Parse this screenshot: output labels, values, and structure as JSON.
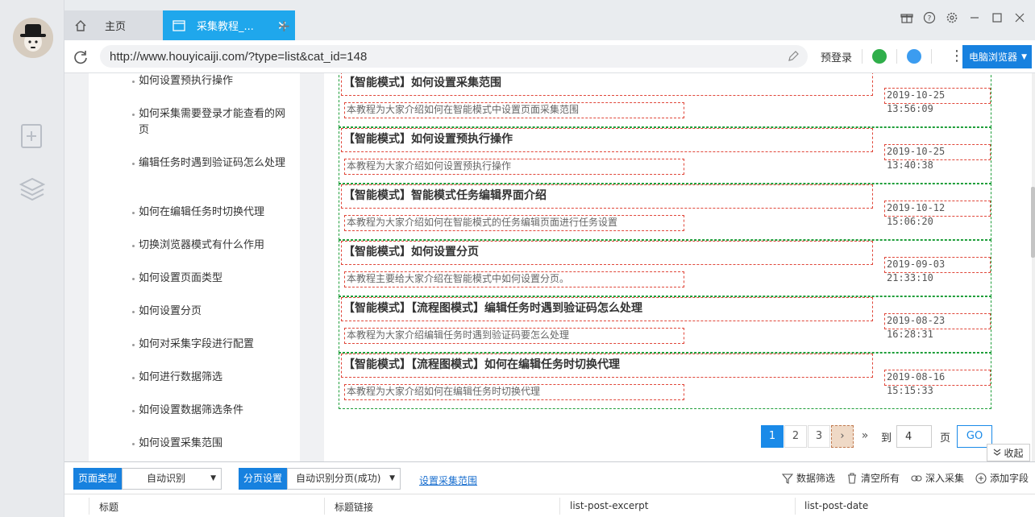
{
  "tabs": {
    "home_label": "主页",
    "active_label": "采集教程_..."
  },
  "address": {
    "url": "http://www.houyicaiji.com/?type=list&cat_id=148",
    "prelogin": "预登录",
    "mode_label": "电脑浏览器"
  },
  "sidenav": {
    "items": [
      "如何设置预执行操作",
      "如何采集需要登录才能查看的网页",
      "编辑任务时遇到验证码怎么处理",
      "如何在编辑任务时切换代理",
      "切换浏览器模式有什么作用",
      "如何设置页面类型",
      "如何设置分页",
      "如何对采集字段进行配置",
      "如何进行数据筛选",
      "如何设置数据筛选条件",
      "如何设置采集范围"
    ]
  },
  "articles": [
    {
      "title": "【智能模式】如何设置采集范围",
      "excerpt": "本教程为大家介绍如何在智能模式中设置页面采集范围",
      "date": "2019-10-25 13:56:09"
    },
    {
      "title": "【智能模式】如何设置预执行操作",
      "excerpt": "本教程为大家介绍如何设置预执行操作",
      "date": "2019-10-25 13:40:38"
    },
    {
      "title": "【智能模式】智能模式任务编辑界面介绍",
      "excerpt": "本教程为大家介绍如何在智能模式的任务编辑页面进行任务设置",
      "date": "2019-10-12 15:06:20"
    },
    {
      "title": "【智能模式】如何设置分页",
      "excerpt": "本教程主要给大家介绍在智能模式中如何设置分页。",
      "date": "2019-09-03 21:33:10"
    },
    {
      "title": "【智能模式】【流程图模式】编辑任务时遇到验证码怎么处理",
      "excerpt": "本教程为大家介绍编辑任务时遇到验证码要怎么处理",
      "date": "2019-08-23 16:28:31"
    },
    {
      "title": "【智能模式】【流程图模式】如何在编辑任务时切换代理",
      "excerpt": "本教程为大家介绍如何在编辑任务时切换代理",
      "date": "2019-08-16 15:15:33"
    }
  ],
  "pager": {
    "pages": [
      "1",
      "2",
      "3"
    ],
    "next": "›",
    "last": "»",
    "to_label": "到",
    "input_value": "4",
    "page_label": "页",
    "go_label": "GO"
  },
  "collapse_label": "收起",
  "toolbar": {
    "page_type_label": "页面类型",
    "page_type_value": "自动识别",
    "paging_label": "分页设置",
    "paging_value": "自动识别分页(成功)",
    "range_link": "设置采集范围",
    "filter": "数据筛选",
    "clear": "清空所有",
    "deep": "深入采集",
    "add_field": "添加字段"
  },
  "table": {
    "columns": [
      "标题",
      "标题链接",
      "list-post-excerpt",
      "list-post-date"
    ]
  },
  "colors": {
    "accent": "#1fa7ec",
    "primary": "#1781df",
    "outline_green": "#1e9e3a",
    "outline_red": "#e0473a"
  }
}
